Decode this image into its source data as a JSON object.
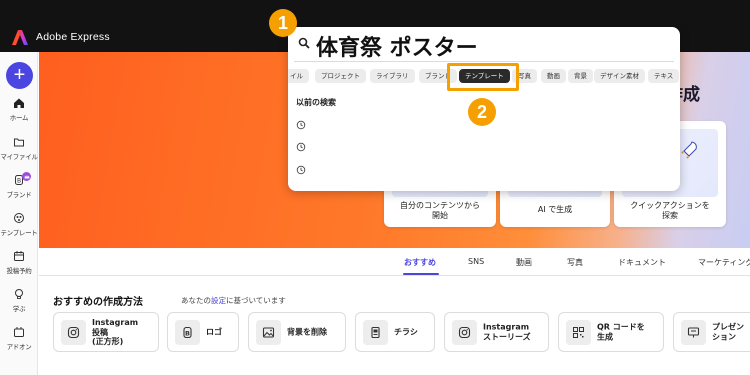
{
  "app": {
    "name": "Adobe Express"
  },
  "sidebar": {
    "create_label": "+",
    "items": [
      {
        "label": "ホーム",
        "icon": "home-icon"
      },
      {
        "label": "マイファイル",
        "icon": "folder-icon"
      },
      {
        "label": "ブランド",
        "icon": "brand-icon"
      },
      {
        "label": "テンプレート",
        "icon": "template-icon"
      },
      {
        "label": "投稿予約",
        "icon": "calendar-icon"
      },
      {
        "label": "学ぶ",
        "icon": "lightbulb-icon"
      },
      {
        "label": "アドオン",
        "icon": "addon-icon"
      }
    ]
  },
  "search": {
    "query": "体育祭 ポスター",
    "chips": [
      "イル",
      "プロジェクト",
      "ライブラリ",
      "ブランド",
      "テンプレート",
      "写真",
      "動画",
      "背景",
      "デザイン素材",
      "テキス"
    ],
    "active_chip": "テンプレート",
    "history_title": "以前の検索"
  },
  "callouts": {
    "first": "1",
    "second": "2"
  },
  "hero": {
    "partial_title": "作成",
    "cards": [
      {
        "label": "自分のコンテンツから\n開始"
      },
      {
        "label": "AI で生成"
      },
      {
        "label": "クイックアクションを\n探索"
      }
    ]
  },
  "tabs": [
    "おすすめ",
    "SNS",
    "動画",
    "写真",
    "ドキュメント",
    "マーケティング"
  ],
  "active_tab": "おすすめ",
  "section": {
    "title": "おすすめの作成方法",
    "subtitle_prefix": "あなたの",
    "subtitle_link": "設定",
    "subtitle_suffix": "に基づいています"
  },
  "methods": [
    {
      "label": "Instagram\n投稿\n(正方形)",
      "icon": "instagram-icon"
    },
    {
      "label": "ロゴ",
      "icon": "logo-icon"
    },
    {
      "label": "背景を削除",
      "icon": "image-icon"
    },
    {
      "label": "チラシ",
      "icon": "flyer-icon"
    },
    {
      "label": "Instagram\nストーリーズ",
      "icon": "instagram-icon"
    },
    {
      "label": "QR コードを\n生成",
      "icon": "qr-code-icon"
    },
    {
      "label": "プレゼン\nション",
      "icon": "presentation-icon"
    }
  ],
  "colors": {
    "accent": "#4b46e0",
    "topbar": "#121212",
    "hero_orange": "#ff6a24",
    "callout": "#f5a000",
    "brand_crown": "#9b4fd8"
  }
}
